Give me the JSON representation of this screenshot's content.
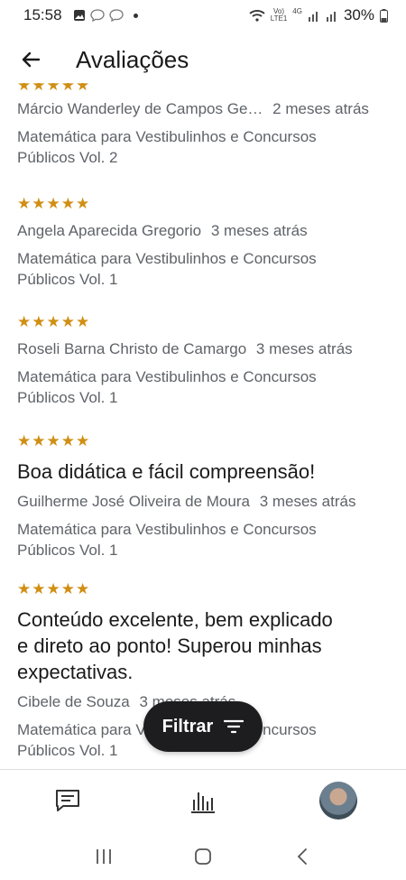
{
  "status_bar": {
    "time": "15:58",
    "volte_top": "Vo)",
    "volte_bottom": "LTE1",
    "network": "4G",
    "battery": "30%"
  },
  "app_bar": {
    "back_icon": "arrow-left-icon",
    "title": "Avaliações"
  },
  "reviews": [
    {
      "rating": 5,
      "stars": "★★★★★",
      "author": "Márcio Wanderley de Campos Ge…",
      "date": "2 meses atrás",
      "book_line1": "Matemática para Vestibulinhos e Concursos",
      "book_line2": "Públicos Vol. 2"
    },
    {
      "rating": 5,
      "stars": "★★★★★",
      "author": "Angela Aparecida Gregorio",
      "date": "3 meses atrás",
      "book_line1": "Matemática para Vestibulinhos e Concursos",
      "book_line2": "Públicos Vol. 1"
    },
    {
      "rating": 5,
      "stars": "★★★★★",
      "author": "Roseli Barna Christo de Camargo",
      "date": "3 meses atrás",
      "book_line1": "Matemática para Vestibulinhos e Concursos",
      "book_line2": "Públicos Vol. 1"
    },
    {
      "rating": 5,
      "stars": "★★★★★",
      "title": "Boa didática e fácil compreensão!",
      "author": "Guilherme José Oliveira de Moura",
      "date": "3 meses atrás",
      "book_line1": "Matemática para Vestibulinhos e Concursos",
      "book_line2": "Públicos Vol. 1"
    },
    {
      "rating": 5,
      "stars": "★★★★★",
      "title_line1": "Conteúdo excelente, bem explicado",
      "title_line2": "e direto ao ponto! Superou minhas",
      "title_line3": "expectativas.",
      "author": "Cibele de Souza",
      "date": "3 meses atrás",
      "book_line1": "Matemática para Vestibulinhos e Concursos",
      "book_line2": "Públicos Vol. 1"
    }
  ],
  "filter_button": {
    "label": "Filtrar",
    "icon": "filter-icon"
  },
  "bottom_nav": {
    "items": [
      "comments-icon",
      "stats-icon",
      "avatar"
    ]
  },
  "colors": {
    "star": "#d08f14",
    "secondary_text": "#5f6368",
    "filter_bg": "#1d1d1f"
  }
}
